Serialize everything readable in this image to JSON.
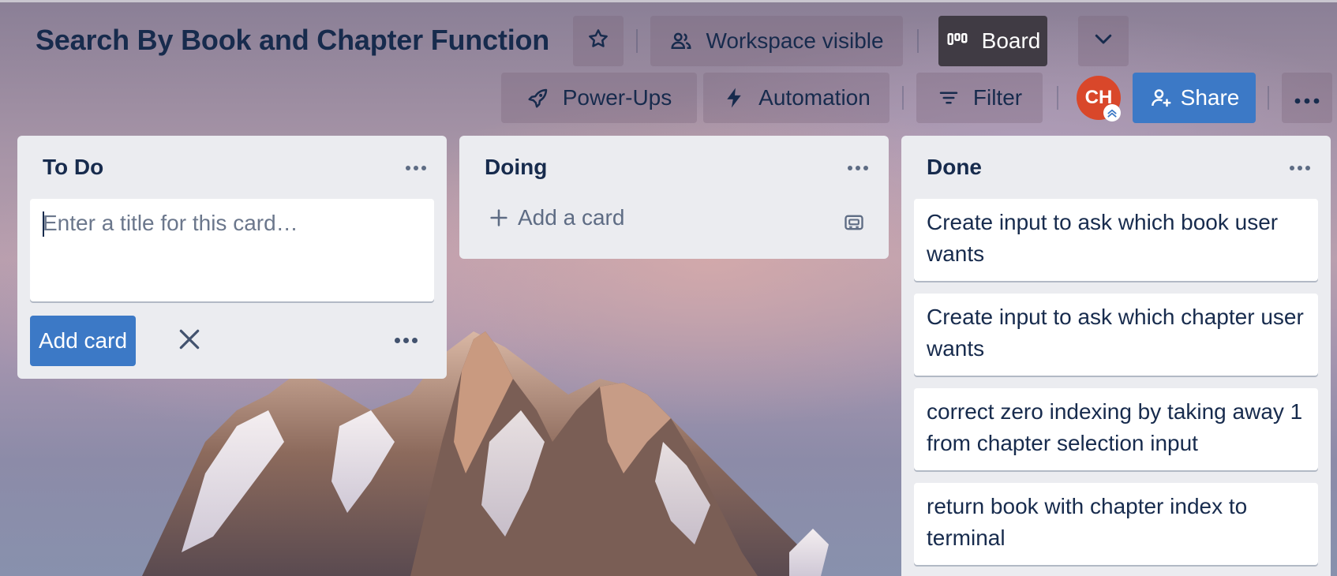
{
  "board": {
    "title": "Search By Book and Chapter Function",
    "visibility_label": "Workspace visible",
    "view_label": "Board"
  },
  "toolbar": {
    "powerups_label": "Power-Ups",
    "automation_label": "Automation",
    "filter_label": "Filter",
    "share_label": "Share",
    "avatar_initials": "CH"
  },
  "lists": {
    "todo": {
      "title": "To Do",
      "composer_placeholder": "Enter a title for this card…",
      "add_button_label": "Add card"
    },
    "doing": {
      "title": "Doing",
      "add_card_label": "Add a card"
    },
    "done": {
      "title": "Done",
      "cards": [
        "Create input to ask which book user wants",
        "Create input to ask which chapter user wants",
        "correct zero indexing by taking away 1 from chapter selection input",
        "return book with chapter index to terminal"
      ]
    }
  },
  "colors": {
    "brand_blue": "#3c79c6",
    "avatar_red": "#d9472a",
    "board_button_dark": "#403b44",
    "list_bg": "#ebecf0",
    "text_primary": "#172b4d"
  },
  "icons": {
    "star": "star-icon",
    "workspace": "workspace-visible-icon",
    "board": "board-icon",
    "chevron": "chevron-down-icon",
    "powerups": "rocket-icon",
    "automation": "lightning-icon",
    "filter": "filter-icon",
    "share": "add-person-icon",
    "more": "more-icon",
    "close": "close-icon",
    "plus": "plus-icon",
    "template": "template-icon"
  }
}
